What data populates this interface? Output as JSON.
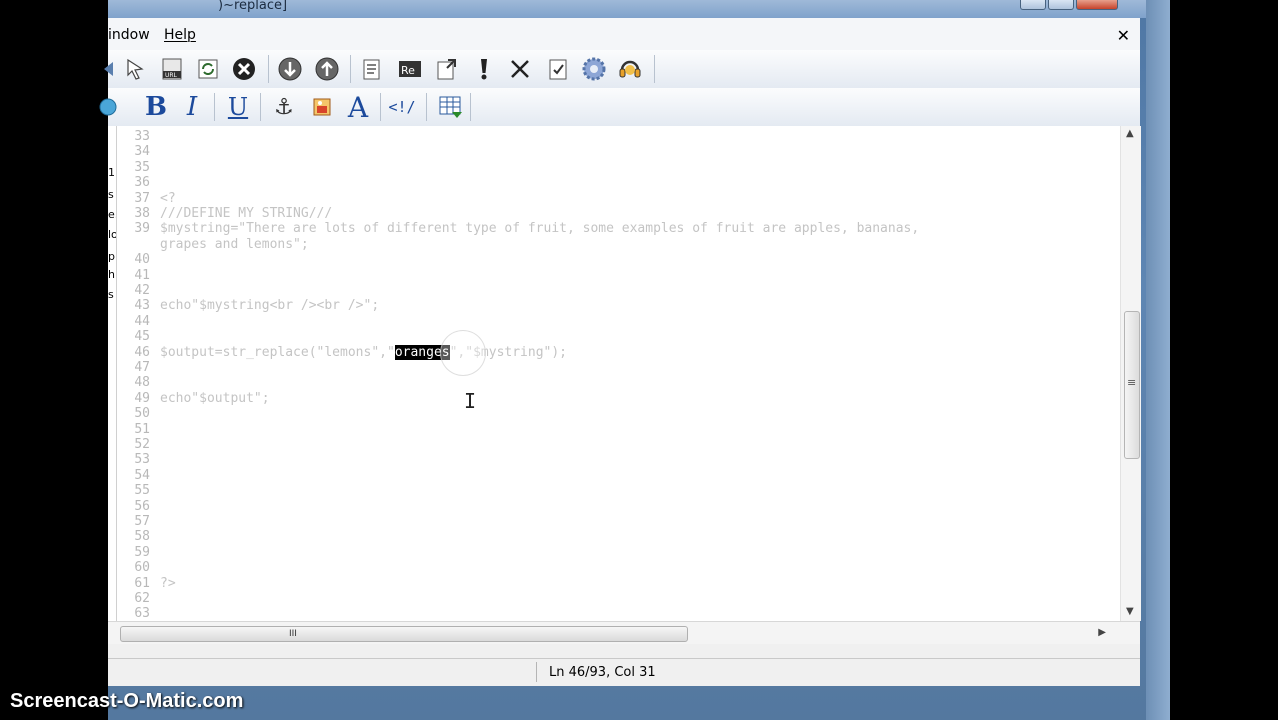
{
  "window": {
    "title": ")~replace]"
  },
  "menu": {
    "items": [
      {
        "label": "indow"
      },
      {
        "label": "Help"
      }
    ],
    "close_glyph": "✕"
  },
  "toolbar1": {
    "icons": [
      "back-arrow-icon",
      "pointer-icon",
      "url-icon",
      "refresh-icon",
      "stop-icon",
      "down-arrow-icon",
      "up-arrow-icon",
      "document-list-icon",
      "regex-icon",
      "open-file-icon",
      "exclamation-icon",
      "delete-x-icon",
      "checklist-icon",
      "settings-gear-icon",
      "headphones-icon"
    ]
  },
  "toolbar2": {
    "bold": "B",
    "italic": "I",
    "underline": "U",
    "anchor": "⚓",
    "font": "A",
    "tag": "<!/",
    "icons": [
      "globe-icon",
      "bold-icon",
      "italic-icon",
      "underline-icon",
      "anchor-icon",
      "image-icon",
      "font-icon",
      "comment-tag-icon",
      "table-icon"
    ]
  },
  "editor": {
    "lines": [
      {
        "n": "33",
        "code": ""
      },
      {
        "n": "34",
        "code": ""
      },
      {
        "n": "35",
        "code": ""
      },
      {
        "n": "36",
        "code": ""
      },
      {
        "n": "37",
        "code": "<?"
      },
      {
        "n": "38",
        "code": "///DEFINE MY STRING///"
      },
      {
        "n": "39",
        "code": "$mystring=\"There are lots of different type of fruit, some examples of fruit are apples, bananas,"
      },
      {
        "n": "",
        "code": "grapes and lemons\";"
      },
      {
        "n": "40",
        "code": ""
      },
      {
        "n": "41",
        "code": ""
      },
      {
        "n": "42",
        "code": ""
      },
      {
        "n": "43",
        "code": "echo\"$mystring<br /><br />\";"
      },
      {
        "n": "44",
        "code": ""
      },
      {
        "n": "45",
        "code": ""
      },
      {
        "n": "46",
        "code_before": "$output=str_replace(\"lemons\",\"",
        "code_hl": "oranges",
        "code_after": "\",\"$mystring\");"
      },
      {
        "n": "47",
        "code": ""
      },
      {
        "n": "48",
        "code": ""
      },
      {
        "n": "49",
        "code": "echo\"$output\";"
      },
      {
        "n": "50",
        "code": ""
      },
      {
        "n": "51",
        "code": ""
      },
      {
        "n": "52",
        "code": ""
      },
      {
        "n": "53",
        "code": ""
      },
      {
        "n": "54",
        "code": ""
      },
      {
        "n": "55",
        "code": ""
      },
      {
        "n": "56",
        "code": ""
      },
      {
        "n": "57",
        "code": ""
      },
      {
        "n": "58",
        "code": ""
      },
      {
        "n": "59",
        "code": ""
      },
      {
        "n": "60",
        "code": ""
      },
      {
        "n": "61",
        "code": "?>"
      },
      {
        "n": "62",
        "code": ""
      },
      {
        "n": "63",
        "code": ""
      }
    ],
    "left_strip_letters": [
      "1.",
      "s",
      "e.",
      "lo",
      "p",
      "h",
      "s"
    ]
  },
  "hscroll": {
    "thumb_glyph": "III"
  },
  "vscroll": {
    "thumb_glyph": "≡"
  },
  "status": {
    "position": "Ln 46/93, Col 31"
  },
  "watermark": "Screencast-O-Matic.com"
}
